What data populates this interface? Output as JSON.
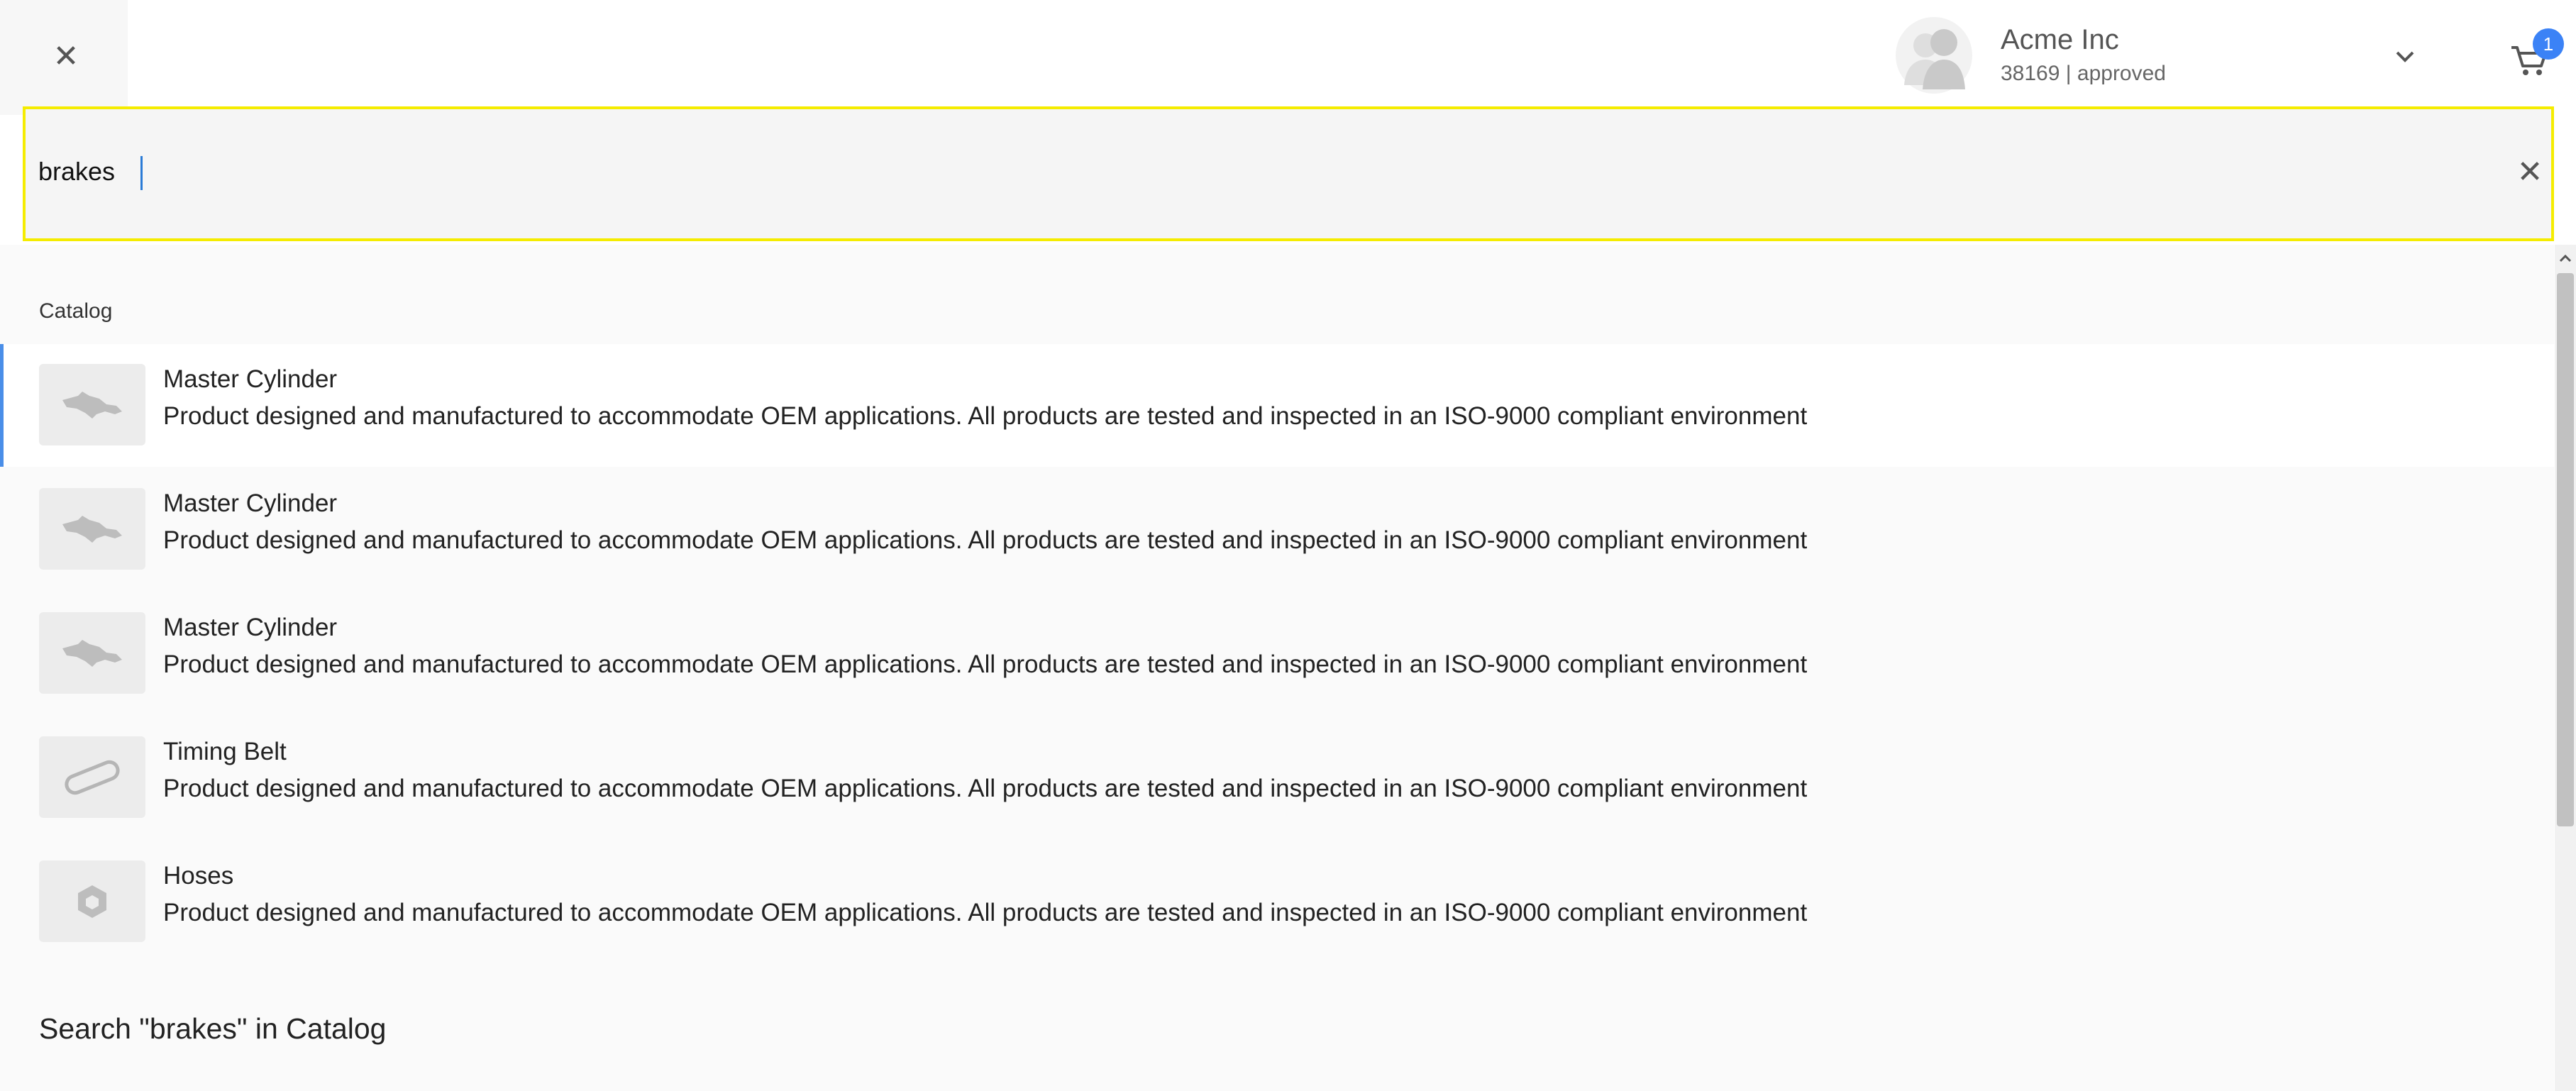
{
  "close_icon": "close-icon",
  "account": {
    "name": "Acme Inc",
    "subtitle": "38169 | approved"
  },
  "cart": {
    "count": "1"
  },
  "search": {
    "value": "brakes",
    "placeholder": ""
  },
  "catalog": {
    "section_label": "Catalog",
    "items": [
      {
        "title": "Master Cylinder",
        "description": "Product designed and manufactured to accommodate OEM applications. All products are tested and inspected in an ISO-9000 compliant environment",
        "icon": "master-cylinder-image"
      },
      {
        "title": "Master Cylinder",
        "description": "Product designed and manufactured to accommodate OEM applications. All products are tested and inspected in an ISO-9000 compliant environment",
        "icon": "master-cylinder-image"
      },
      {
        "title": "Master Cylinder",
        "description": "Product designed and manufactured to accommodate OEM applications. All products are tested and inspected in an ISO-9000 compliant environment",
        "icon": "master-cylinder-image"
      },
      {
        "title": "Timing Belt",
        "description": "Product designed and manufactured to accommodate OEM applications. All products are tested and inspected in an ISO-9000 compliant environment",
        "icon": "timing-belt-image"
      },
      {
        "title": "Hoses",
        "description": "Product designed and manufactured to accommodate OEM applications. All products are tested and inspected in an ISO-9000 compliant environment",
        "icon": "product-placeholder-icon"
      }
    ],
    "search_all_label": "Search \"brakes\" in Catalog"
  },
  "colors": {
    "highlight_border": "#f5ec00",
    "badge": "#3b82f6",
    "active_accent": "#4a8ee8"
  }
}
